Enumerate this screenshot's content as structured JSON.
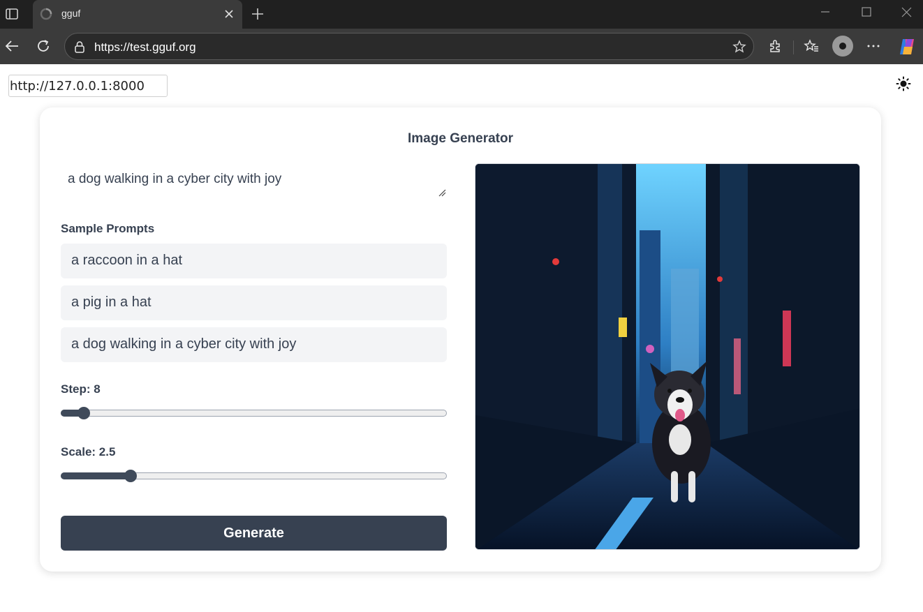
{
  "browser": {
    "tab_title": "gguf",
    "url": "https://test.gguf.org"
  },
  "page": {
    "server_url": "http://127.0.0.1:8000",
    "title": "Image Generator",
    "prompt": "a dog walking in a cyber city with joy",
    "sample_prompts_label": "Sample Prompts",
    "sample_prompts": [
      "a raccoon in a hat",
      "a pig in a hat",
      "a dog walking in a cyber city with joy"
    ],
    "step_label": "Step: 8",
    "step": {
      "value": 8,
      "fraction": 0.06
    },
    "scale_label": "Scale: 2.5",
    "scale": {
      "value": 2.5,
      "fraction": 0.18
    },
    "generate_label": "Generate"
  },
  "colors": {
    "primary": "#374151",
    "sample_bg": "#f3f4f6"
  }
}
